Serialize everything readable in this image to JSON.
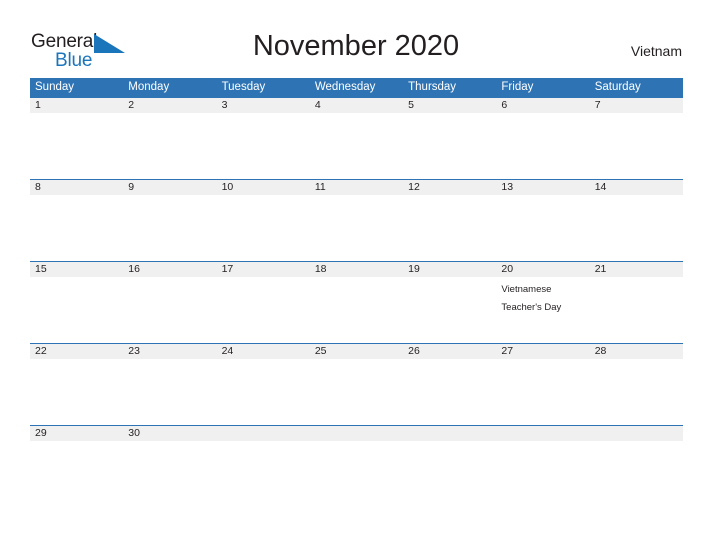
{
  "brand": {
    "name_part1": "General",
    "name_part2": "Blue",
    "flag_icon": "blue-triangle-flag-icon",
    "color_dark": "#231f20",
    "color_blue": "#1b75bb"
  },
  "header": {
    "title": "November 2020",
    "country": "Vietnam"
  },
  "theme": {
    "header_bar_color": "#2e74b5",
    "date_band_color": "#f0f0f0",
    "separator_color": "#2e74b5",
    "text_color": "#231f20",
    "header_text_color": "#ffffff"
  },
  "calendar": {
    "weekdays": [
      "Sunday",
      "Monday",
      "Tuesday",
      "Wednesday",
      "Thursday",
      "Friday",
      "Saturday"
    ],
    "weeks": [
      {
        "dates": [
          "1",
          "2",
          "3",
          "4",
          "5",
          "6",
          "7"
        ],
        "events": [
          "",
          "",
          "",
          "",
          "",
          "",
          ""
        ]
      },
      {
        "dates": [
          "8",
          "9",
          "10",
          "11",
          "12",
          "13",
          "14"
        ],
        "events": [
          "",
          "",
          "",
          "",
          "",
          "",
          ""
        ]
      },
      {
        "dates": [
          "15",
          "16",
          "17",
          "18",
          "19",
          "20",
          "21"
        ],
        "events": [
          "",
          "",
          "",
          "",
          "",
          "Vietnamese\nTeacher's Day",
          ""
        ]
      },
      {
        "dates": [
          "22",
          "23",
          "24",
          "25",
          "26",
          "27",
          "28"
        ],
        "events": [
          "",
          "",
          "",
          "",
          "",
          "",
          ""
        ]
      },
      {
        "dates": [
          "29",
          "30",
          "",
          "",
          "",
          "",
          ""
        ],
        "events": [
          "",
          "",
          "",
          "",
          "",
          "",
          ""
        ]
      }
    ]
  }
}
